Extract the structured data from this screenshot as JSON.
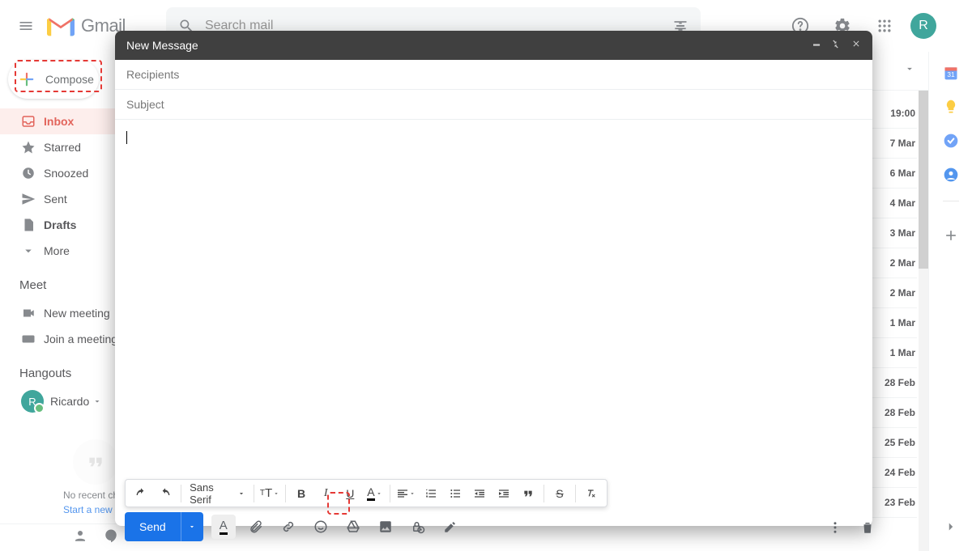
{
  "header": {
    "logo_text": "Gmail",
    "search_placeholder": "Search mail",
    "avatar_initial": "R"
  },
  "sidebar": {
    "compose_label": "Compose",
    "items": [
      {
        "label": "Inbox",
        "active": true
      },
      {
        "label": "Starred"
      },
      {
        "label": "Snoozed"
      },
      {
        "label": "Sent"
      },
      {
        "label": "Drafts",
        "bold": true
      },
      {
        "label": "More"
      }
    ],
    "meet_heading": "Meet",
    "meet_items": [
      {
        "label": "New meeting"
      },
      {
        "label": "Join a meeting"
      }
    ],
    "hangouts_heading": "Hangouts",
    "hangouts_user": "Ricardo",
    "no_recent_text": "No recent chats",
    "start_new_text": "Start a new one"
  },
  "mail": {
    "dates": [
      "19:00",
      "7 Mar",
      "6 Mar",
      "4 Mar",
      "3 Mar",
      "2 Mar",
      "2 Mar",
      "1 Mar",
      "1 Mar",
      "28 Feb",
      "28 Feb",
      "25 Feb",
      "24 Feb",
      "23 Feb"
    ]
  },
  "compose": {
    "title": "New Message",
    "recipients_placeholder": "Recipients",
    "subject_placeholder": "Subject",
    "font_name": "Sans Serif",
    "send_label": "Send"
  }
}
